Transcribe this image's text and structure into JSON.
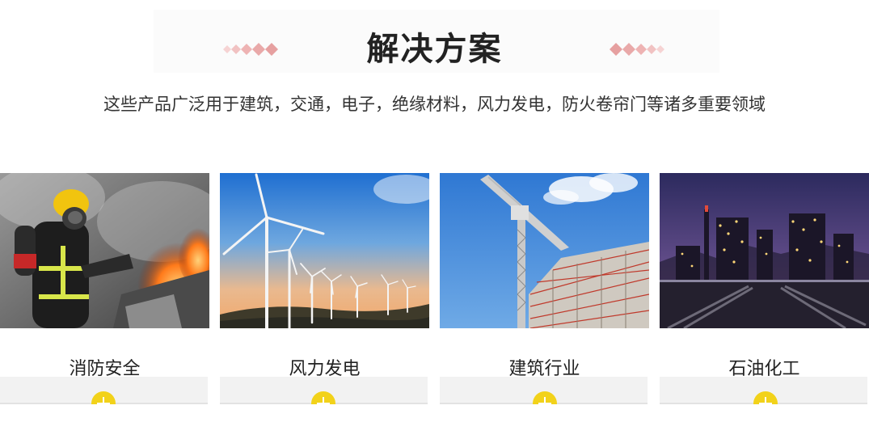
{
  "section": {
    "title": "解决方案",
    "subtitle": "这些产品广泛用于建筑，交通，电子，绝缘材料，风力发电，防火卷帘门等诸多重要领域"
  },
  "colors": {
    "accent": "#f2d21a",
    "decoration": "#e9a9a9"
  },
  "cards": [
    {
      "label": "消防安全",
      "image": "firefighter-photo",
      "icon": "plus-icon"
    },
    {
      "label": "风力发电",
      "image": "wind-turbines-photo",
      "icon": "plus-icon"
    },
    {
      "label": "建筑行业",
      "image": "construction-crane-photo",
      "icon": "plus-icon"
    },
    {
      "label": "石油化工",
      "image": "petrochemical-plant-photo",
      "icon": "plus-icon"
    }
  ]
}
